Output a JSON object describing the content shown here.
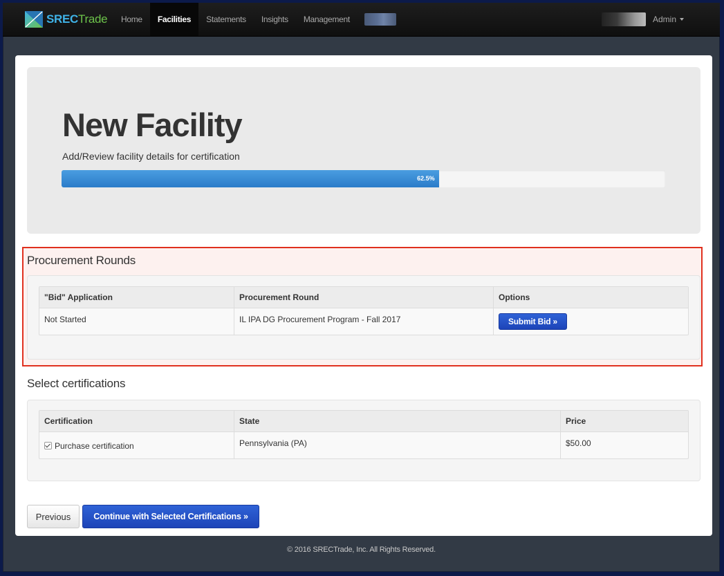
{
  "navbar": {
    "brand_s": "SREC",
    "brand_t": "Trade",
    "items": [
      {
        "label": "Home"
      },
      {
        "label": "Facilities"
      },
      {
        "label": "Statements"
      },
      {
        "label": "Insights"
      },
      {
        "label": "Management"
      }
    ],
    "active_item": "Facilities",
    "user_label": "Admin"
  },
  "jumbotron": {
    "title": "New Facility",
    "subtitle": "Add/Review facility details for certification",
    "progress_percent": 62.5,
    "progress_label": "62.5%"
  },
  "procurement": {
    "title": "Procurement Rounds",
    "headers": {
      "bid_application": "\"Bid\" Application",
      "procurement_round": "Procurement Round",
      "options": "Options"
    },
    "row": {
      "bid_application": "Not Started",
      "procurement_round": "IL IPA DG Procurement Program - Fall 2017",
      "action_label": "Submit Bid »"
    }
  },
  "certifications": {
    "title": "Select certifications",
    "headers": {
      "certification": "Certification",
      "state": "State",
      "price": "Price"
    },
    "row": {
      "certification": "Purchase certification",
      "checked": true,
      "state": "Pennsylvania (PA)",
      "price": "$50.00"
    }
  },
  "actions": {
    "previous_label": "Previous",
    "continue_label": "Continue with Selected Certifications »"
  },
  "footer": {
    "text": "© 2016 SRECTrade, Inc. All Rights Reserved."
  },
  "colors": {
    "highlight_border": "#e0301e",
    "primary_button": "#2548c2",
    "progress_bar": "#3a8dd6"
  }
}
